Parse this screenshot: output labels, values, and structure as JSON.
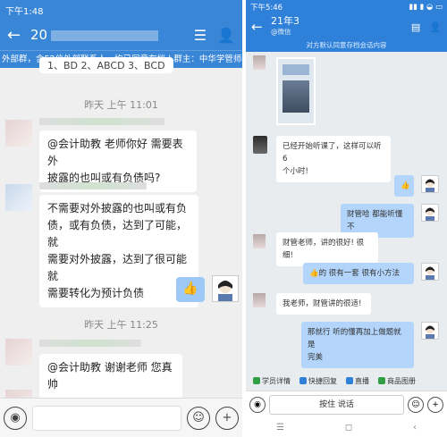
{
  "left": {
    "status": {
      "time": "下午1:48",
      "network": "4G",
      "battery": "43"
    },
    "title": {
      "group_name": "20"
    },
    "notice": "外部群，含52位外部联系人，均已同意存档 | 群主：中华学管师猪...",
    "prev_text": "1、BD 2、ABCD 3、BCD",
    "messages": [
      {
        "time": "昨天 上午 11:01"
      },
      {
        "text_line1": "@会计助教 老师你好 需要表外",
        "text_line2": "披露的也叫或有负债吗?"
      },
      {
        "line1": "不需要对外披露的也叫或有负",
        "line2": "债，或有负债，达到了可能，就",
        "line3": "需要对外披露，达到了很可能就",
        "line4": "需要转化为预计负债"
      },
      {
        "emoji": "👍"
      },
      {
        "time": "昨天 上午 11:25"
      },
      {
        "text": "@会计助教 谢谢老师 您真帅"
      }
    ]
  },
  "right": {
    "status": {
      "time": "下午5:46"
    },
    "title": {
      "name": "21年3",
      "sub": "@微信"
    },
    "notice": "对方默认同意存档会话内容",
    "messages": [
      {
        "text_line1": "已经开始听课了，这样可以听6",
        "text_line2": "个小时!"
      },
      {
        "emoji": "👍"
      },
      {
        "text": "财管哈 都能听懂不"
      },
      {
        "text": "财管老师，讲的很好! 很细!"
      },
      {
        "text": "👍的 很有一套 很有小方法"
      },
      {
        "text": "我老师，财管讲的很适!"
      },
      {
        "text_line1": "那就行 听的懂再加上做题就是",
        "text_line2": "完美"
      }
    ],
    "toolbar": [
      {
        "label": "学员详情",
        "color": "#2f9e44"
      },
      {
        "label": "快捷回复",
        "color": "#2f80d8"
      },
      {
        "label": "直播",
        "color": "#2f80d8"
      },
      {
        "label": "商品图册",
        "color": "#2f9e44"
      }
    ],
    "input": {
      "talk": "按住 说话"
    },
    "nav": {
      "menu": "☰",
      "home": "◻",
      "back": "‹"
    }
  }
}
